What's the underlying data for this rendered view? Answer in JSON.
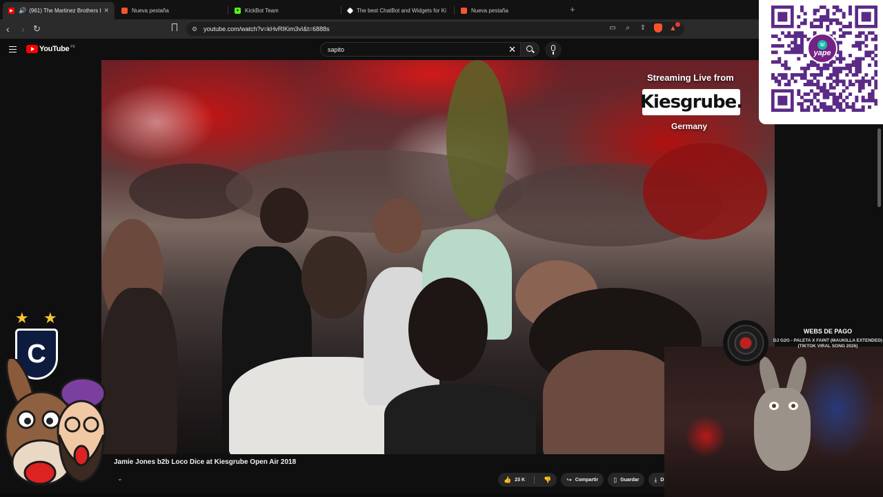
{
  "tabs": [
    {
      "title": "(961) The Martinez Brothers I",
      "active": true
    },
    {
      "title": "Nueva pestaña",
      "active": false
    },
    {
      "title": "KickBot Team",
      "active": false
    },
    {
      "title": "The best ChatBot and Widgets for Ki",
      "active": false
    },
    {
      "title": "Nueva pestaña",
      "active": false
    }
  ],
  "toolbar": {
    "url": "youtube.com/watch?v=kHvRIKim3vI&t=6888s"
  },
  "youtube": {
    "logo_text": "YouTube",
    "region": "PE",
    "search_query": "sapito"
  },
  "video": {
    "overlay_line1": "Streaming Live from",
    "overlay_brand": "Kiesgrube.",
    "overlay_line2": "Germany",
    "title": "Jamie Jones b2b Loco Dice at Kiesgrube Open Air 2018"
  },
  "actions": {
    "likes": "23 K",
    "share": "Compartir",
    "save": "Guardar",
    "download": "Desc"
  },
  "qr": {
    "brand": "yape"
  },
  "music_widget": {
    "heading": "WEBS DE PAGO",
    "track": "DJ G2G - PALETA X FAINT (MAUKILLA EXTENDED) (TIKTOK VIRAL SONG 2026)"
  },
  "colors": {
    "youtube_red": "#ff0000",
    "browser_bg": "#2b2b2b",
    "page_bg": "#0f0f0f",
    "yape_purple": "#742284"
  }
}
